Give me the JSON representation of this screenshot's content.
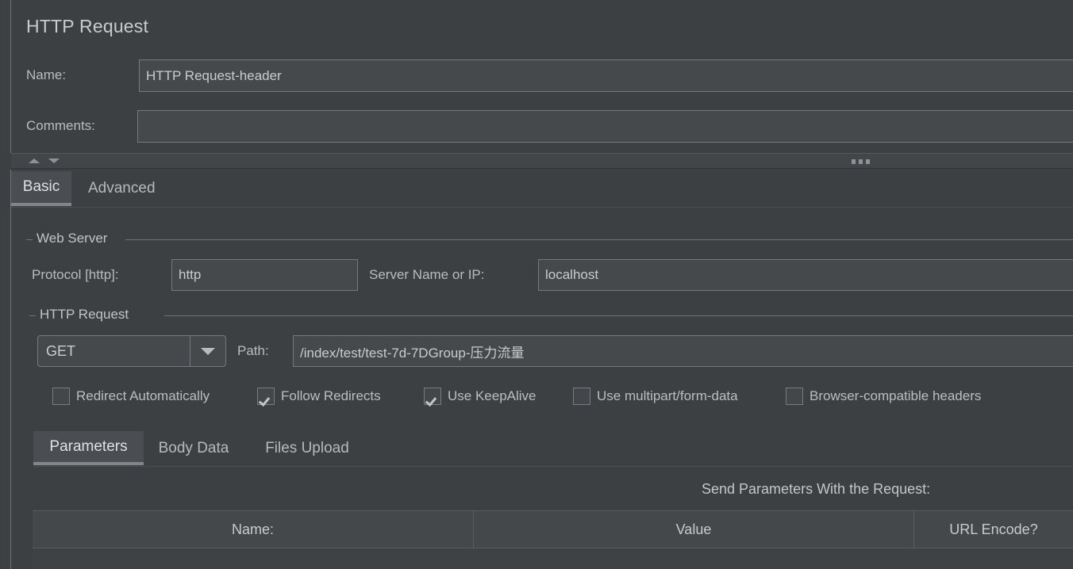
{
  "panel": {
    "title": "HTTP Request"
  },
  "header": {
    "name_label": "Name:",
    "name_value": "HTTP Request-header",
    "comments_label": "Comments:",
    "comments_value": ""
  },
  "splitter": {
    "collapse_up_icon": "triangle-up-icon",
    "collapse_down_icon": "triangle-down-icon",
    "grip_icon": "grip-dots-icon"
  },
  "tabs": [
    {
      "label": "Basic",
      "active": true
    },
    {
      "label": "Advanced",
      "active": false
    }
  ],
  "web_server": {
    "group_label": "Web Server",
    "protocol_label": "Protocol [http]:",
    "protocol_value": "http",
    "server_label": "Server Name or IP:",
    "server_value": "localhost"
  },
  "http_request": {
    "group_label": "HTTP Request",
    "method_value": "GET",
    "method_dropdown_icon": "chevron-down-icon",
    "path_label": "Path:",
    "path_value": "/index/test/test-7d-7DGroup-压力流量"
  },
  "options": [
    {
      "label": "Redirect Automatically",
      "checked": false
    },
    {
      "label": "Follow Redirects",
      "checked": true
    },
    {
      "label": "Use KeepAlive",
      "checked": true
    },
    {
      "label": "Use multipart/form-data",
      "checked": false
    },
    {
      "label": "Browser-compatible headers",
      "checked": false
    }
  ],
  "sub_tabs": [
    {
      "label": "Parameters",
      "active": true
    },
    {
      "label": "Body Data",
      "active": false
    },
    {
      "label": "Files Upload",
      "active": false
    }
  ],
  "parameters_panel": {
    "caption": "Send Parameters With the Request:",
    "columns": [
      "Name:",
      "Value",
      "URL Encode?"
    ],
    "rows": []
  },
  "colors": {
    "window_background": "#3c4043",
    "field_background": "#46494c",
    "field_border": "#74797d",
    "text_primary": "#c9cbcc",
    "text_secondary": "#b9bcbe",
    "active_tab_background": "#4a4e52",
    "active_tab_underline": "#81868b",
    "separator": "#6d7276",
    "table_header_background": "#45484b"
  }
}
